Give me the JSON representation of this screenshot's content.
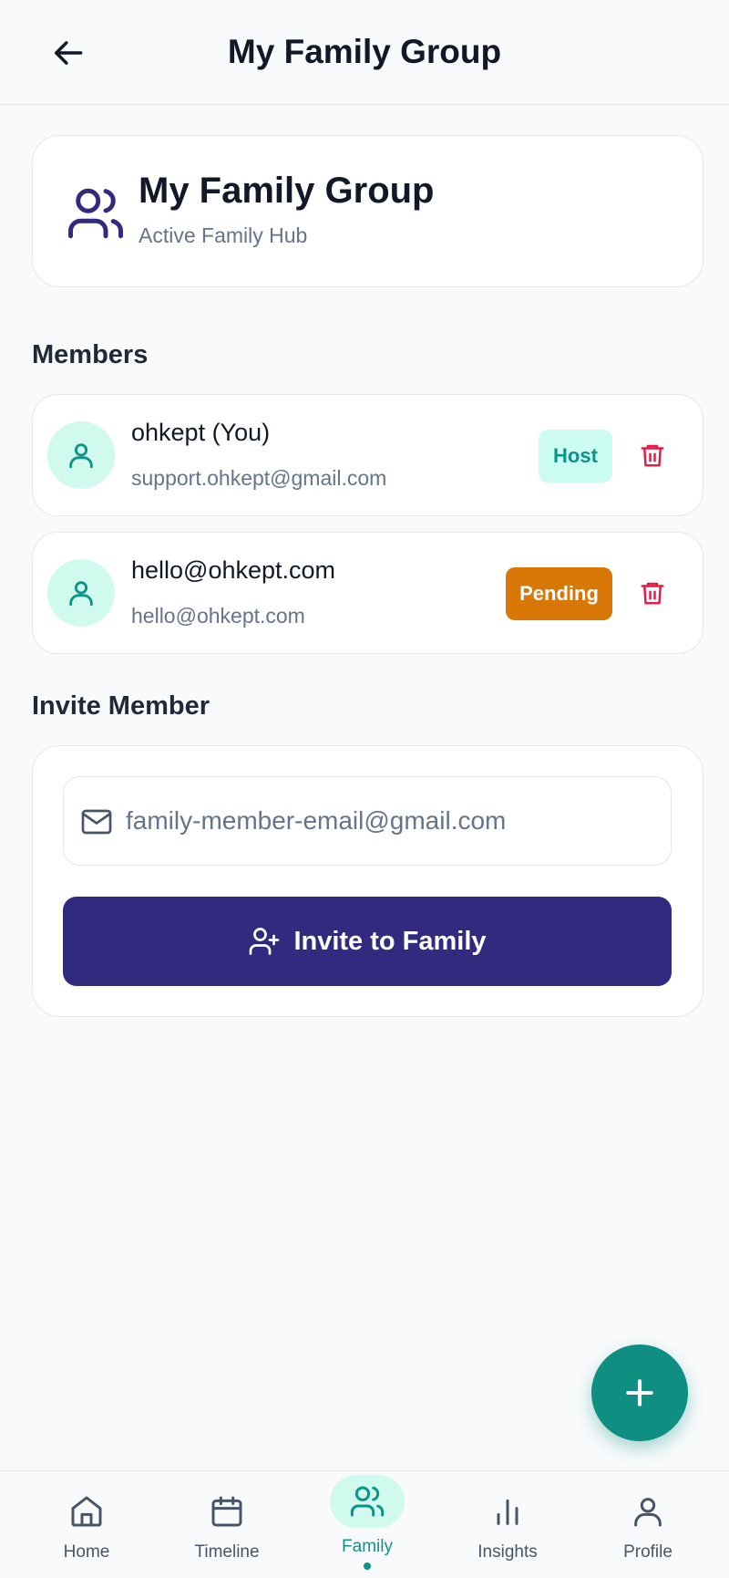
{
  "header": {
    "title": "My Family Group"
  },
  "group": {
    "name": "My Family Group",
    "status": "Active Family Hub"
  },
  "members_section": {
    "label": "Members",
    "members": [
      {
        "name": "ohkept (You)",
        "email": "support.ohkept@gmail.com",
        "badge": "Host"
      },
      {
        "name": "hello@ohkept.com",
        "email": "hello@ohkept.com",
        "badge": "Pending"
      }
    ]
  },
  "invite_section": {
    "label": "Invite Member",
    "email_placeholder": "family-member-email@gmail.com",
    "email_value": "",
    "button_label": "Invite to Family"
  },
  "colors": {
    "primary": "#312a7f",
    "accent": "#0d9488",
    "pending": "#d97706",
    "danger": "#e11d48"
  },
  "nav": {
    "items": [
      {
        "label": "Home",
        "icon": "home-icon"
      },
      {
        "label": "Timeline",
        "icon": "calendar-icon"
      },
      {
        "label": "Family",
        "icon": "users-icon",
        "active": true
      },
      {
        "label": "Insights",
        "icon": "bar-chart-icon"
      },
      {
        "label": "Profile",
        "icon": "user-icon"
      }
    ]
  }
}
